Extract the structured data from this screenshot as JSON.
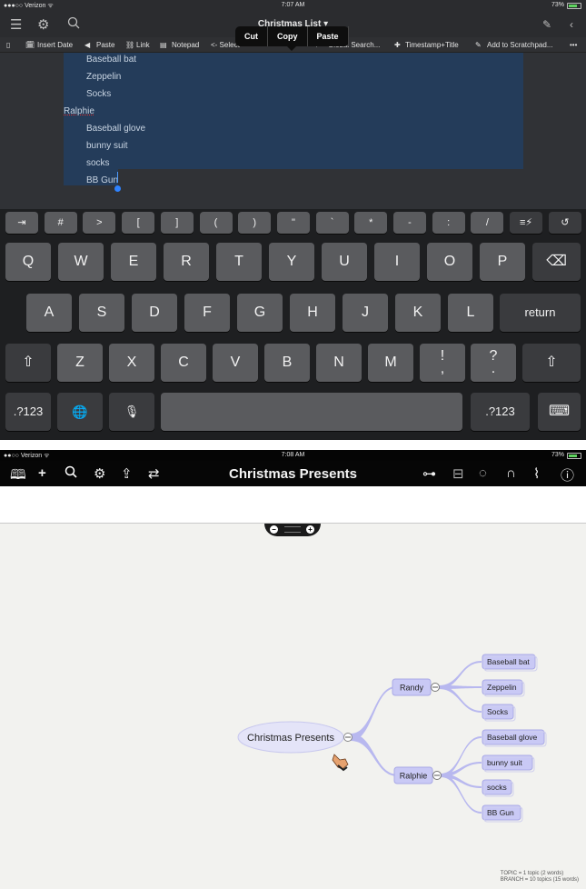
{
  "top": {
    "status": {
      "carrier": "●●●○○ Verizon ᯤ",
      "time": "7:07 AM",
      "battery": "73%"
    },
    "nav": {
      "title": "Christmas List ▾"
    },
    "popup": {
      "cut": "Cut",
      "copy": "Copy",
      "paste": "Paste"
    },
    "toolbar": {
      "insert_date": "Insert Date",
      "paste": "Paste",
      "link": "Link",
      "notepad": "Notepad",
      "select": "<- Select",
      "global_search": "Global Search...",
      "timestamp": "Timestamp+Title",
      "scratchpad": "Add to Scratchpad...",
      "more": "•••"
    },
    "editor": {
      "lines": [
        {
          "text": "Baseball bat",
          "indent": 1
        },
        {
          "text": "Zeppelin",
          "indent": 1
        },
        {
          "text": "Socks",
          "indent": 1
        },
        {
          "text": "Ralphie",
          "indent": 0
        },
        {
          "text": "Baseball glove",
          "indent": 1
        },
        {
          "text": "bunny suit",
          "indent": 1
        },
        {
          "text": "socks",
          "indent": 1
        },
        {
          "text": "BB Gun",
          "indent": 1
        }
      ]
    },
    "keyboard": {
      "row0": [
        "⇥",
        "#",
        ">",
        "[",
        "]",
        "(",
        ")",
        "\"",
        "`",
        "*",
        "-",
        ":",
        "/",
        "≡⚡",
        "↺"
      ],
      "row1": [
        "Q",
        "W",
        "E",
        "R",
        "T",
        "Y",
        "U",
        "I",
        "O",
        "P"
      ],
      "row2": [
        "A",
        "S",
        "D",
        "F",
        "G",
        "H",
        "J",
        "K",
        "L"
      ],
      "row3": [
        "Z",
        "X",
        "C",
        "V",
        "B",
        "N",
        "M"
      ],
      "return": "return",
      "numbers": ".?123",
      "excl": "!\n,",
      "quest": "?\n."
    }
  },
  "bottom": {
    "status": {
      "carrier": "●●○○ Verizon ᯤ",
      "time": "7:08 AM",
      "battery": "73%"
    },
    "nav": {
      "title": "Christmas Presents"
    },
    "map": {
      "root": "Christmas Presents",
      "branches": [
        {
          "label": "Randy",
          "children": [
            "Baseball bat",
            "Zeppelin",
            "Socks"
          ]
        },
        {
          "label": "Ralphie",
          "children": [
            "Baseball glove",
            "bunny suit",
            "socks",
            "BB Gun"
          ]
        }
      ],
      "node_color": "#c9c9f5",
      "branch_color": "#b8b8ef"
    },
    "stats": {
      "topic": "TOPIC = 1 topic (2 words)",
      "branch": "BRANCH = 10 topics (15 words)"
    }
  }
}
